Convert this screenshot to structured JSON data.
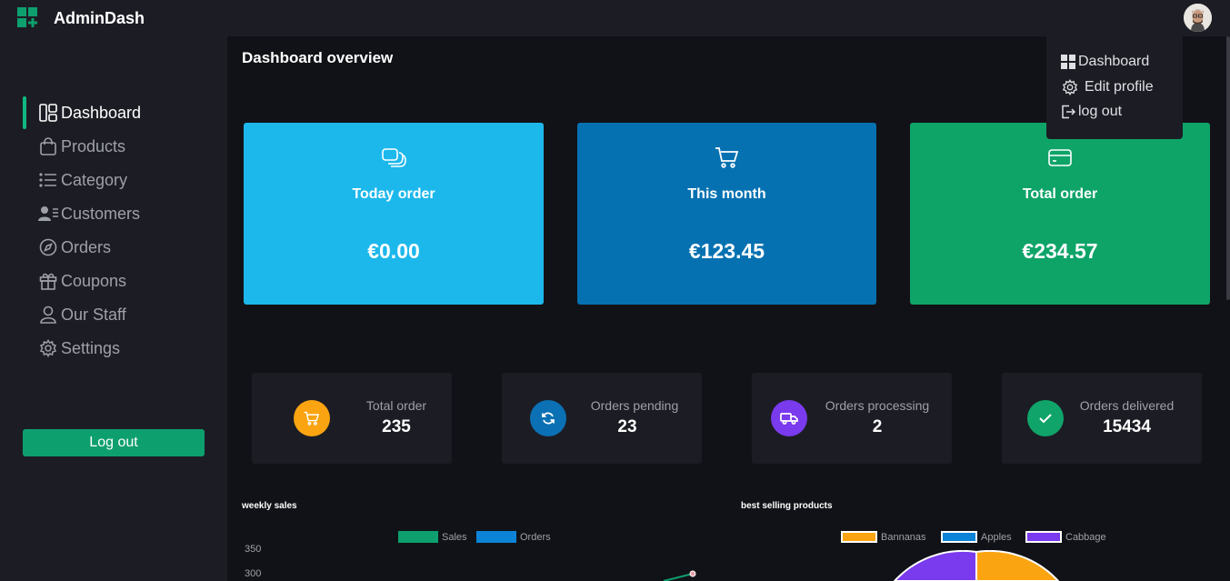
{
  "app": {
    "name": "AdminDash"
  },
  "topbar": {
    "avatar_icon": "avatar-icon"
  },
  "sidebar": {
    "items": [
      {
        "label": "Dashboard",
        "icon": "grid-icon",
        "active": true
      },
      {
        "label": "Products",
        "icon": "bag-icon"
      },
      {
        "label": "Category",
        "icon": "list-icon"
      },
      {
        "label": "Customers",
        "icon": "users-icon"
      },
      {
        "label": "Orders",
        "icon": "compass-icon"
      },
      {
        "label": "Coupons",
        "icon": "gift-icon"
      },
      {
        "label": "Our Staff",
        "icon": "user-icon"
      },
      {
        "label": "Settings",
        "icon": "gear-icon"
      }
    ],
    "logout_label": "Log out"
  },
  "main": {
    "title": "Dashboard overview",
    "cards": [
      {
        "title": "Today order",
        "value": "€0.00",
        "color": "#1cb8ec",
        "icon": "layers-icon"
      },
      {
        "title": "This month",
        "value": "€123.45",
        "color": "#0571b1",
        "icon": "cart-icon"
      },
      {
        "title": "Total order",
        "value": "€234.57",
        "color": "#0ea468",
        "icon": "credit-card-icon"
      }
    ],
    "stats": [
      {
        "label": "Total order",
        "value": "235",
        "color": "#fba411",
        "icon": "cart-icon"
      },
      {
        "label": "Orders pending",
        "value": "23",
        "color": "#0b71b4",
        "icon": "refresh-icon"
      },
      {
        "label": "Orders processing",
        "value": "2",
        "color": "#7a3aed",
        "icon": "truck-icon"
      },
      {
        "label": "Orders delivered",
        "value": "15434",
        "color": "#10a46a",
        "icon": "check-icon"
      }
    ]
  },
  "weekly_sales": {
    "title": "weekly sales",
    "legend": [
      {
        "label": "Sales",
        "color": "#0e9f6e"
      },
      {
        "label": "Orders",
        "color": "#0b84d8"
      }
    ],
    "yticks": [
      "350",
      "300"
    ]
  },
  "best_selling": {
    "title": "best selling products",
    "legend": [
      {
        "label": "Bannanas",
        "color": "#fba411"
      },
      {
        "label": "Apples",
        "color": "#0b84d8"
      },
      {
        "label": "Cabbage",
        "color": "#7a3aed"
      }
    ]
  },
  "dropdown": {
    "items": [
      {
        "label": "Dashboard",
        "icon": "grid-icon"
      },
      {
        "label": "Edit profile",
        "icon": "gear-icon"
      },
      {
        "label": "log out",
        "icon": "logout-icon"
      }
    ]
  }
}
